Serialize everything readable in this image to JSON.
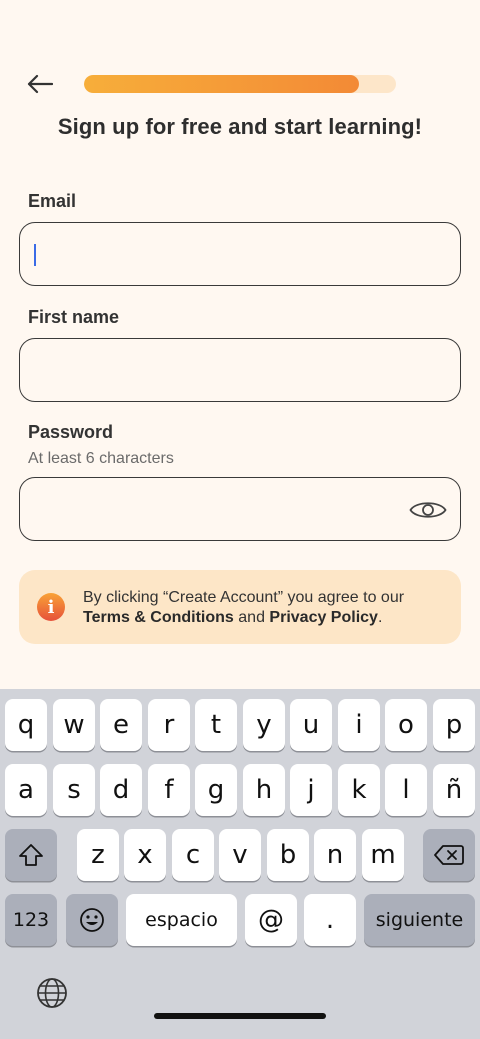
{
  "header": {
    "back_icon": "arrow-left-icon",
    "progress_fraction": 0.88,
    "progress_colors": [
      "#F7AE3A",
      "#F38A36"
    ],
    "track_color": "#FDE6C9"
  },
  "title": "Sign up for free and start learning!",
  "form": {
    "email": {
      "label": "Email",
      "value": "",
      "placeholder": ""
    },
    "first_name": {
      "label": "First name",
      "value": "",
      "placeholder": ""
    },
    "password": {
      "label": "Password",
      "hint": "At least 6 characters",
      "value": "",
      "placeholder": "",
      "toggle_icon": "eye-icon"
    }
  },
  "notice": {
    "icon": "info-icon",
    "icon_glyph": "i",
    "text_before": "By clicking “Create Account” you agree to our ",
    "terms": "Terms & Conditions",
    "and": " and ",
    "privacy": "Privacy Policy",
    "text_after": "."
  },
  "keyboard": {
    "row1": [
      "q",
      "w",
      "e",
      "r",
      "t",
      "y",
      "u",
      "i",
      "o",
      "p"
    ],
    "row2": [
      "a",
      "s",
      "d",
      "f",
      "g",
      "h",
      "j",
      "k",
      "l",
      "ñ"
    ],
    "row3": [
      "z",
      "x",
      "c",
      "v",
      "b",
      "n",
      "m"
    ],
    "shift_icon": "shift-icon",
    "backspace_icon": "backspace-icon",
    "numbers": "123",
    "emoji_icon": "emoji-icon",
    "space": "espacio",
    "at": "@",
    "dot": ".",
    "next": "siguiente",
    "globe_icon": "globe-icon"
  }
}
